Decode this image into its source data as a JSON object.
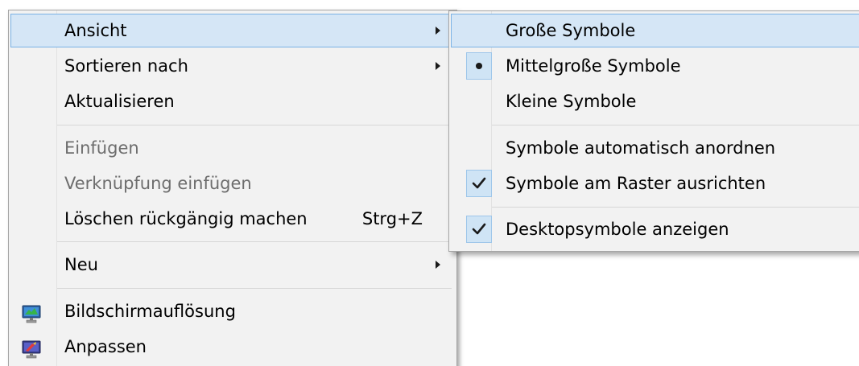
{
  "context_menu": {
    "items": [
      {
        "label": "Ansicht",
        "submenu": true,
        "highlighted": true
      },
      {
        "label": "Sortieren nach",
        "submenu": true
      },
      {
        "label": "Aktualisieren"
      },
      {
        "label": "Einfügen",
        "disabled": true
      },
      {
        "label": "Verknüpfung einfügen",
        "disabled": true
      },
      {
        "label": "Löschen rückgängig machen",
        "shortcut": "Strg+Z"
      },
      {
        "label": "Neu",
        "submenu": true
      },
      {
        "label": "Bildschirmauflösung",
        "icon": "display-resolution-icon"
      },
      {
        "label": "Anpassen",
        "icon": "personalize-icon"
      }
    ]
  },
  "view_submenu": {
    "items": [
      {
        "label": "Große Symbole",
        "highlighted": true
      },
      {
        "label": "Mittelgroße Symbole",
        "marker": "bullet"
      },
      {
        "label": "Kleine Symbole"
      },
      {
        "label": "Symbole automatisch anordnen"
      },
      {
        "label": "Symbole am Raster ausrichten",
        "marker": "check"
      },
      {
        "label": "Desktopsymbole anzeigen",
        "marker": "check"
      }
    ]
  },
  "colors": {
    "menu_background": "#f2f2f2",
    "highlight_fill": "#d5e6f6",
    "highlight_border": "#7ab2e5",
    "disabled_text": "#6d6d6d"
  }
}
